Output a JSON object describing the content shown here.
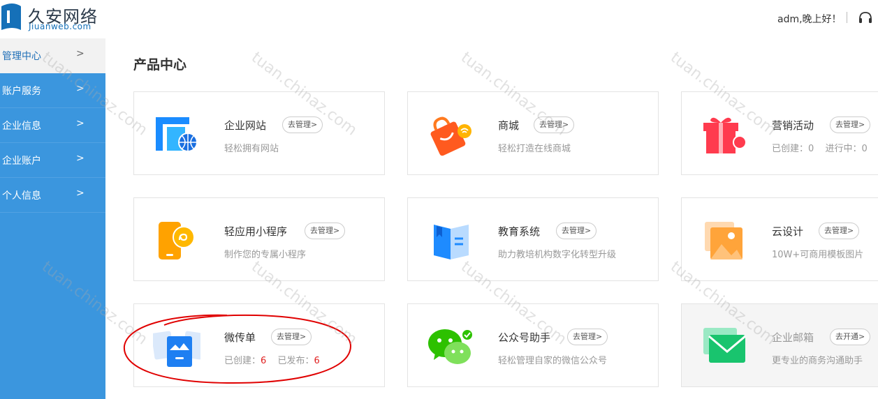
{
  "brand": {
    "name_cn": "久安网络",
    "name_en": "Jiuanweb.com"
  },
  "header": {
    "greeting": "adm,晚上好！",
    "support_icon": "headset-icon"
  },
  "sidebar": {
    "items": [
      {
        "label": "管理中心",
        "active": true
      },
      {
        "label": "账户服务"
      },
      {
        "label": "企业信息"
      },
      {
        "label": "企业账户"
      },
      {
        "label": "个人信息"
      }
    ],
    "chevron": ">"
  },
  "main": {
    "title": "产品中心",
    "cards": [
      {
        "name": "企业网站",
        "button": "去管理>",
        "desc": "轻松拥有网站",
        "icon": "website-icon"
      },
      {
        "name": "商城",
        "button": "去管理>",
        "desc": "轻松打造在线商城",
        "icon": "shopping-bag-icon"
      },
      {
        "name": "营销活动",
        "button": "去管理>",
        "stat1_label": "已创建：",
        "stat1_value": "0",
        "stat2_label": "进行中：",
        "stat2_value": "0",
        "icon": "gift-icon"
      },
      {
        "name": "轻应用小程序",
        "button": "去管理>",
        "desc": "制作您的专属小程序",
        "icon": "mini-program-icon"
      },
      {
        "name": "教育系统",
        "button": "去管理>",
        "desc": "助力教培机构数字化转型升级",
        "icon": "book-icon"
      },
      {
        "name": "云设计",
        "button": "去管理>",
        "desc": "10W+可商用模板图片",
        "icon": "image-icon"
      },
      {
        "name": "微传单",
        "button": "去管理>",
        "stat1_label": "已创建：",
        "stat1_value": "6",
        "stat2_label": "已发布：",
        "stat2_value": "6",
        "icon": "flyer-icon"
      },
      {
        "name": "公众号助手",
        "button": "去管理>",
        "desc": "轻松管理自家的微信公众号",
        "icon": "wechat-icon"
      },
      {
        "name": "企业邮箱",
        "button": "去开通>",
        "desc": "更专业的商务沟通助手",
        "icon": "mail-icon"
      }
    ]
  },
  "watermark": "tuan.chinaz.com",
  "colors": {
    "sidebar": "#3b96de",
    "active_text": "#1f6fb7",
    "stat_red": "#e02020",
    "annotation": "#e00000"
  }
}
